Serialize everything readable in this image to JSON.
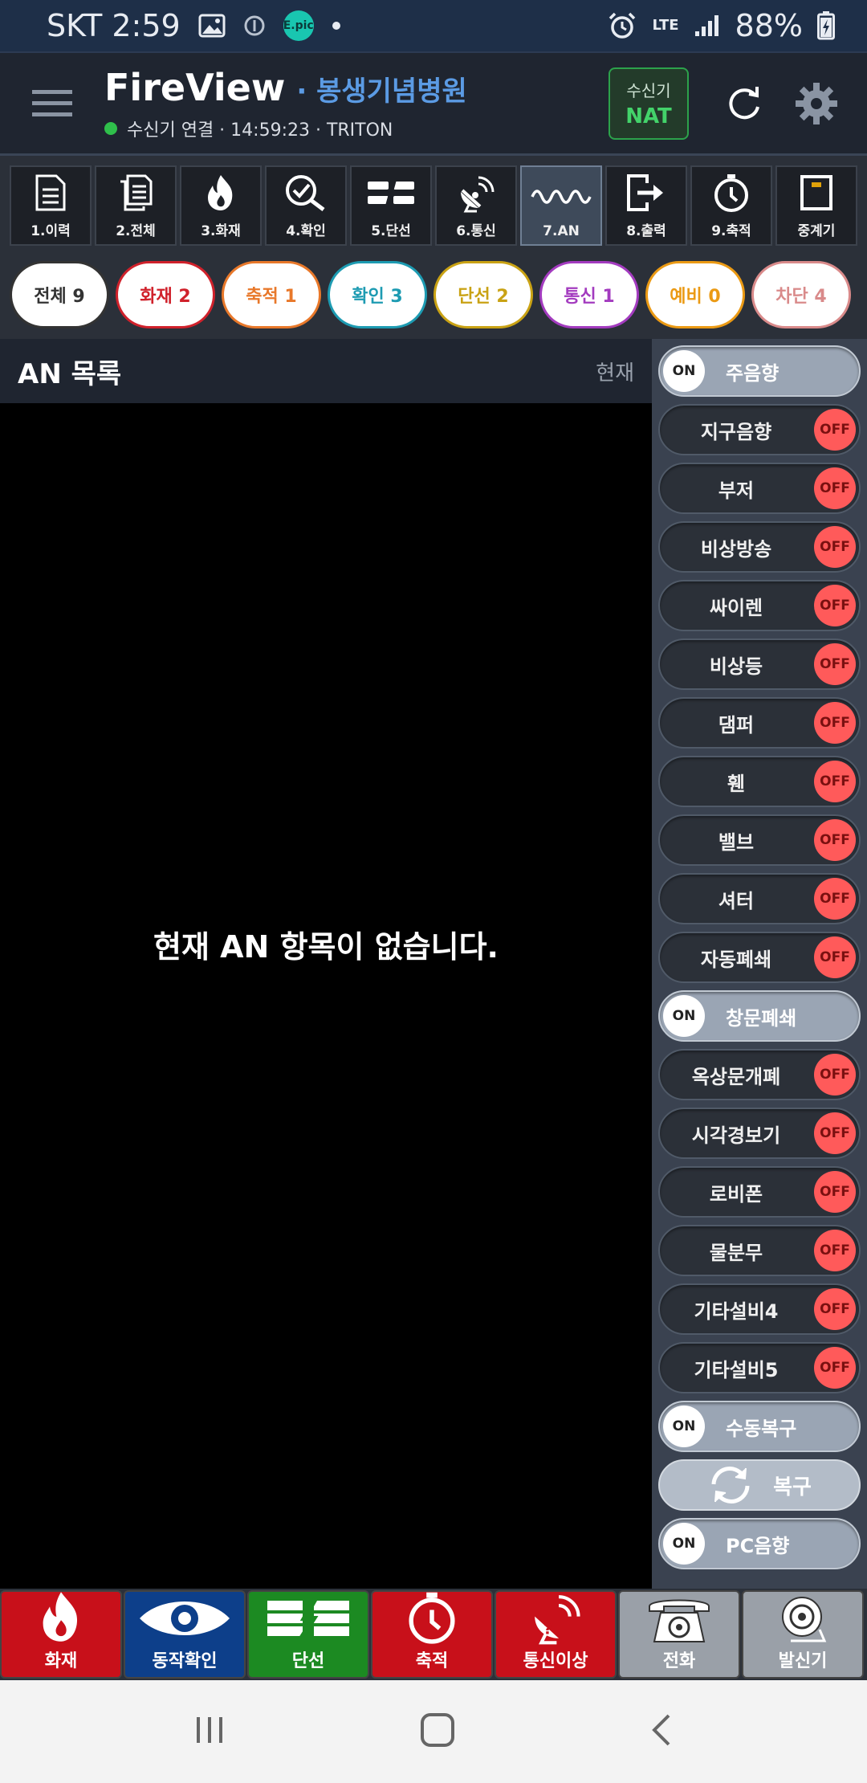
{
  "status_bar": {
    "carrier_time": "SKT 2:59",
    "network": "LTE",
    "battery": "88%",
    "epic_badge": "E.pic"
  },
  "header": {
    "title": "FireView",
    "hospital": "· 봉생기념병원",
    "connection": "수신기 연결 · 14:59:23 · TRITON",
    "receiver_label": "수신기",
    "receiver_value": "NAT"
  },
  "tabs": [
    {
      "label": "1.이력",
      "icon": "document-icon"
    },
    {
      "label": "2.전체",
      "icon": "documents-icon"
    },
    {
      "label": "3.화재",
      "icon": "fire-icon"
    },
    {
      "label": "4.확인",
      "icon": "check-magnifier-icon"
    },
    {
      "label": "5.단선",
      "icon": "broken-line-icon"
    },
    {
      "label": "6.통신",
      "icon": "satellite-icon"
    },
    {
      "label": "7.AN",
      "icon": "wave-icon"
    },
    {
      "label": "8.출력",
      "icon": "output-icon"
    },
    {
      "label": "9.축적",
      "icon": "timer-icon"
    },
    {
      "label": "중계기",
      "icon": "relay-icon"
    }
  ],
  "chips": [
    {
      "label": "전체 9",
      "color": "#333333"
    },
    {
      "label": "화재 2",
      "color": "#d0212b"
    },
    {
      "label": "축적 1",
      "color": "#e8782a"
    },
    {
      "label": "확인 3",
      "color": "#1d9bb2"
    },
    {
      "label": "단선 2",
      "color": "#c9a214"
    },
    {
      "label": "통신 1",
      "color": "#a33bbf"
    },
    {
      "label": "예비 0",
      "color": "#eb9a14"
    },
    {
      "label": "차단 4",
      "color": "#d98a8a"
    }
  ],
  "list": {
    "title": "AN 목록",
    "right_label": "현재",
    "empty_message": "현재 AN 항목이 없습니다."
  },
  "switches": [
    {
      "name": "주음향",
      "state": "ON"
    },
    {
      "name": "지구음향",
      "state": "OFF"
    },
    {
      "name": "부저",
      "state": "OFF"
    },
    {
      "name": "비상방송",
      "state": "OFF"
    },
    {
      "name": "싸이렌",
      "state": "OFF"
    },
    {
      "name": "비상등",
      "state": "OFF"
    },
    {
      "name": "댐퍼",
      "state": "OFF"
    },
    {
      "name": "휀",
      "state": "OFF"
    },
    {
      "name": "밸브",
      "state": "OFF"
    },
    {
      "name": "셔터",
      "state": "OFF"
    },
    {
      "name": "자동폐쇄",
      "state": "OFF"
    },
    {
      "name": "창문폐쇄",
      "state": "ON"
    },
    {
      "name": "옥상문개폐",
      "state": "OFF"
    },
    {
      "name": "시각경보기",
      "state": "OFF"
    },
    {
      "name": "로비폰",
      "state": "OFF"
    },
    {
      "name": "물분무",
      "state": "OFF"
    },
    {
      "name": "기타설비4",
      "state": "OFF"
    },
    {
      "name": "기타설비5",
      "state": "OFF"
    },
    {
      "name": "수동복구",
      "state": "ON"
    }
  ],
  "restore_button": {
    "label": "복구"
  },
  "pc_sound": {
    "name": "PC음향",
    "state": "ON"
  },
  "bottom_buttons": [
    {
      "label": "화재",
      "color": "#c8101a"
    },
    {
      "label": "동작확인",
      "color": "#0d3f8a"
    },
    {
      "label": "단선",
      "color": "#1c8a22"
    },
    {
      "label": "축적",
      "color": "#c8101a"
    },
    {
      "label": "통신이상",
      "color": "#c8101a"
    },
    {
      "label": "전화",
      "color": "#9aa0a8"
    },
    {
      "label": "발신기",
      "color": "#9aa0a8"
    }
  ]
}
